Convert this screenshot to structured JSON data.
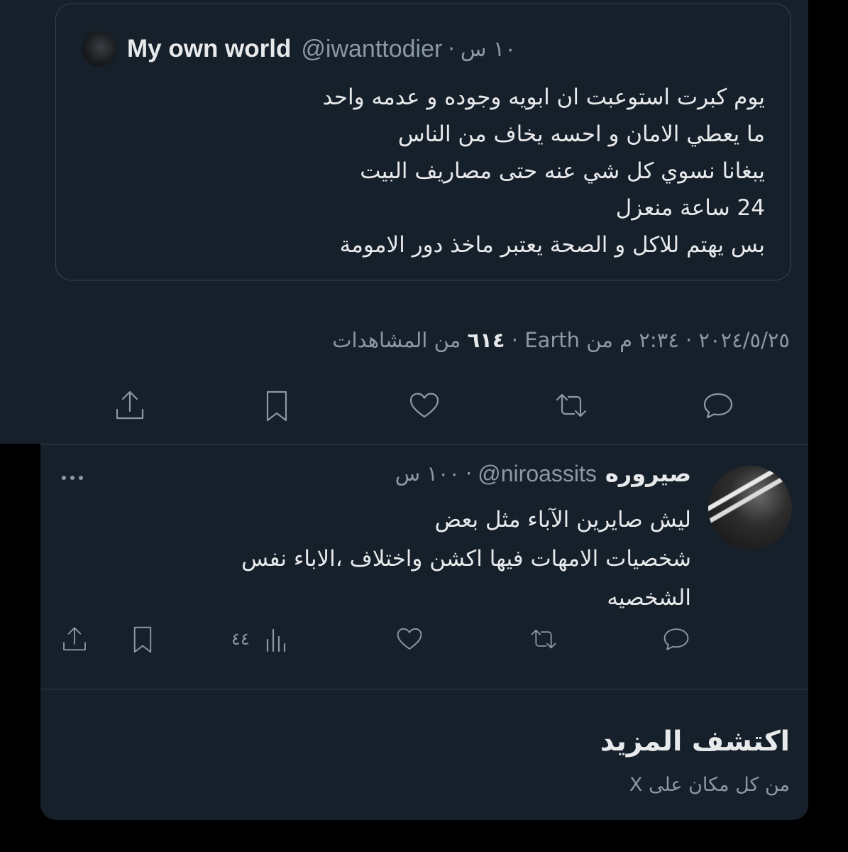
{
  "quoted_tweet": {
    "author_name": "My own world",
    "handle": "@iwanttodier",
    "separator": "·",
    "time": "١٠ س",
    "lines": [
      "يوم كبرت استوعبت ان ابويه وجوده و عدمه واحد",
      "ما يعطي الامان و احسه يخاف من الناس",
      "يبغانا نسوي كل شي عنه حتى مصاريف البيت",
      "24 ساعة منعزل",
      "بس يهتم للاكل و الصحة يعتبر ماخذ دور الامومة"
    ]
  },
  "tweet_meta": {
    "text_before": "٢٠٢٤/٥/٢٥ · ٢:٣٤ م من Earth · ",
    "views_number": "٦١٤",
    "views_label": " من المشاهدات"
  },
  "main_actions": {
    "icons": [
      "reply-icon",
      "retweet-icon",
      "like-icon",
      "bookmark-icon",
      "share-icon"
    ]
  },
  "reply": {
    "author_name": "صيروره",
    "handle": "@niroassits",
    "separator": "·",
    "time": "١٠٠ س",
    "lines": [
      "ليش صايرين الآباء مثل بعض",
      "شخصيات الامهات فيها اكشن واختلاف ،الاباء نفس",
      "الشخصيه"
    ],
    "views_count": "٤٤"
  },
  "discover": {
    "title": "اكتشف المزيد",
    "subtitle": "من كل مكان على X"
  },
  "colors": {
    "background": "#15202b",
    "text": "#e7e9ea",
    "secondary": "#8b98a5",
    "border": "#38444d"
  }
}
